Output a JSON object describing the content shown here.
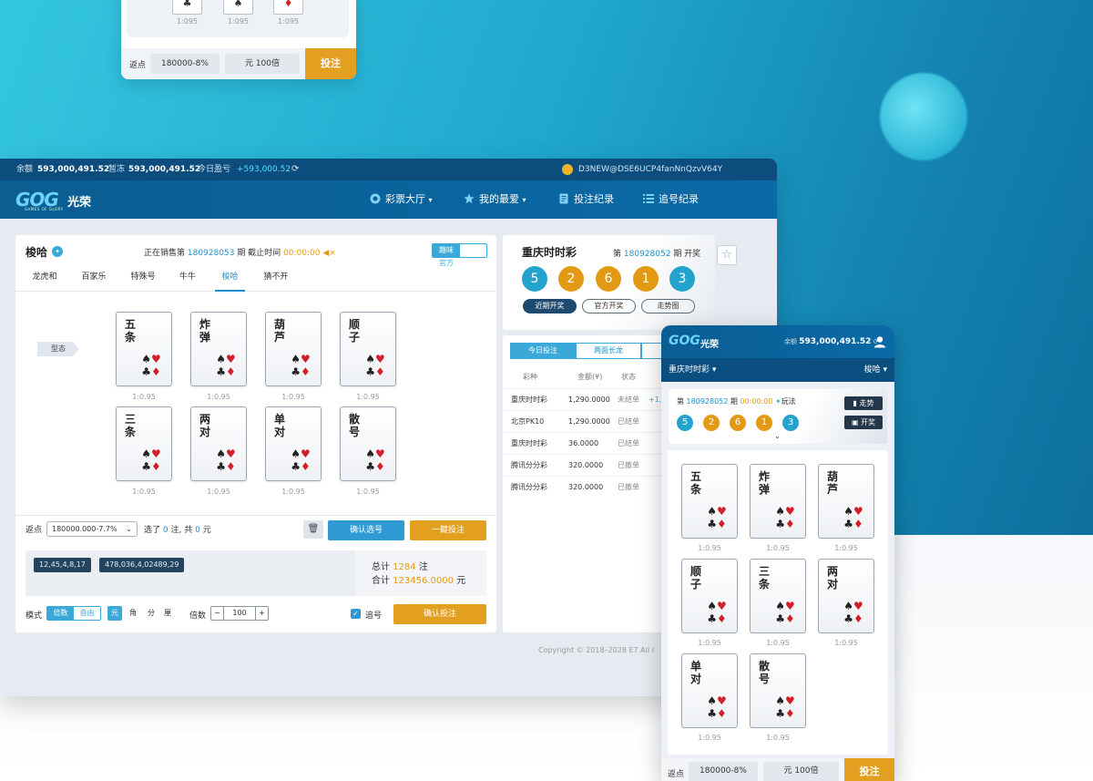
{
  "top_panel": {
    "odds": [
      "1:095",
      "1:095",
      "1:095"
    ],
    "suits": [
      "♣",
      "♠",
      "♦"
    ],
    "rebate_label": "返点",
    "rebate_value": "180000-8%",
    "multiplier": "元 100倍",
    "bet_button": "投注"
  },
  "topbar": {
    "balance_label": "余额",
    "balance": "593,000,491.52",
    "frozen_label": "暂冻",
    "frozen": "593,000,491.52",
    "today_label": "今日盈亏",
    "today": "+593,000.52",
    "refresh_icon": "refresh-icon",
    "user_id": "D3NEW@DSE6UCP4fanNnQzvV64Y"
  },
  "nav": {
    "logo": "GOG",
    "logo_cn": "光荣",
    "logo_sub": "GAMES OF GLORY",
    "items": [
      {
        "label": "彩票大厅",
        "icon": "lottery-icon",
        "caret": "▾"
      },
      {
        "label": "我的最爱",
        "icon": "star-icon",
        "caret": "▾"
      },
      {
        "label": "投注纪录",
        "icon": "document-icon"
      },
      {
        "label": "追号纪录",
        "icon": "list-icon"
      }
    ]
  },
  "game": {
    "title": "梭哈",
    "sale_prefix": "正在销售第",
    "issue": "180928053",
    "sale_mid": "期  截止时间",
    "deadline": "00:00:00",
    "mode_fun": "趣味",
    "mode_official": "官方",
    "tabs": [
      "龙虎和",
      "百家乐",
      "特殊号",
      "牛牛",
      "梭哈",
      "猜不开"
    ],
    "shape_label": "型态",
    "cards": [
      {
        "name": "五条",
        "odds": "1:0.95"
      },
      {
        "name": "炸弹",
        "odds": "1:0.95"
      },
      {
        "name": "葫芦",
        "odds": "1:0.95"
      },
      {
        "name": "顺子",
        "odds": "1:0.95"
      },
      {
        "name": "三条",
        "odds": "1:0.95"
      },
      {
        "name": "两对",
        "odds": "1:0.95"
      },
      {
        "name": "单对",
        "odds": "1:0.95"
      },
      {
        "name": "散号",
        "odds": "1:0.95"
      }
    ],
    "suits": {
      "spade": "♠",
      "heart": "♥",
      "club": "♣",
      "diamond": "♦"
    }
  },
  "betbar": {
    "rebate_label": "返点",
    "rebate_value": "180000.000-7.7%",
    "chosen_prefix": "选了",
    "chosen_count": "0",
    "chosen_mid": "注, 共",
    "chosen_amount": "0",
    "chosen_suffix": "元",
    "confirm_label": "确认选号",
    "quick_label": "一鍵投注"
  },
  "selected": {
    "chips": [
      "12,45,4,8,17",
      "478,036,4,02489,29"
    ],
    "total_label": "总计",
    "total_count": "1284",
    "total_unit": "注",
    "sum_label": "合计",
    "sum_amount": "123456.0000",
    "sum_unit": "元"
  },
  "modebar": {
    "mode_label": "模式",
    "mode_a": "倍数",
    "mode_b": "自由",
    "units": [
      "元",
      "角",
      "分",
      "厘"
    ],
    "mult_label": "倍数",
    "mult_value": "100",
    "minus": "−",
    "plus": "+",
    "chase_label": "追号",
    "confirm_bet": "确认投注"
  },
  "result": {
    "title": "重庆时时彩",
    "issue_prefix": "第",
    "issue": "180928052",
    "issue_suffix": "期 开奖",
    "balls": [
      "5",
      "2",
      "6",
      "1",
      "3"
    ],
    "pills": [
      "近期开奖",
      "官方开奖",
      "走势图"
    ]
  },
  "records": {
    "tabs": [
      "今日投注",
      "两面长龙",
      ""
    ],
    "headers": [
      "彩种",
      "金额(¥)",
      "状态"
    ],
    "rows": [
      {
        "game": "重庆时时彩",
        "amount": "1,290.0000",
        "status": "未结单",
        "extra": "+1,2"
      },
      {
        "game": "北京PK10",
        "amount": "1,290.0000",
        "status": "已结单",
        "extra": ""
      },
      {
        "game": "重庆时时彩",
        "amount": "36.0000",
        "status": "已结单",
        "extra": ""
      },
      {
        "game": "腾讯分分彩",
        "amount": "320.0000",
        "status": "已撤单",
        "extra": ""
      },
      {
        "game": "腾讯分分彩",
        "amount": "320.0000",
        "status": "已撤单",
        "extra": ""
      }
    ]
  },
  "copyright": "Copyright © 2018–2028 E7 All r",
  "mobile": {
    "logo": "GOG",
    "logo_cn": "光荣",
    "balance_label": "余额",
    "balance": "593,000,491.52",
    "lottery": "重庆时时彩",
    "game": "梭哈",
    "issue_prefix": "第",
    "issue": "180928052",
    "issue_mid": "期",
    "time": "00:00:00",
    "play_label": "玩法",
    "trend": "走势",
    "draw": "开奖",
    "balls": [
      "5",
      "2",
      "6",
      "1",
      "3"
    ],
    "cards": [
      {
        "name": "五条",
        "odds": "1:0.95"
      },
      {
        "name": "炸弹",
        "odds": "1:0.95"
      },
      {
        "name": "葫芦",
        "odds": "1:0.95"
      },
      {
        "name": "顺子",
        "odds": "1:0.95"
      },
      {
        "name": "三条",
        "odds": "1:0.95"
      },
      {
        "name": "两对",
        "odds": "1:0.95"
      },
      {
        "name": "单对",
        "odds": "1:0.95"
      },
      {
        "name": "散号",
        "odds": "1:0.95"
      }
    ],
    "rebate_label": "返点",
    "rebate_value": "180000-8%",
    "multiplier": "元 100倍",
    "bet_button": "投注"
  },
  "colors": {
    "accent": "#3aa8d8",
    "gold": "#e3a020",
    "navy": "#0c4d7d"
  }
}
